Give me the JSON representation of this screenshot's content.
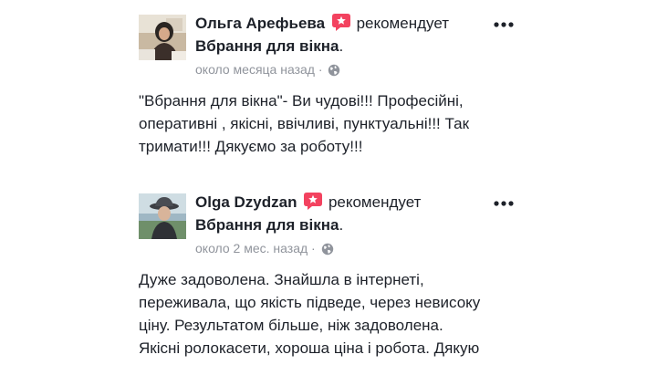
{
  "posts": [
    {
      "author": "Ольга Арефьева",
      "verb": "рекомендует",
      "page": "Вбрання для вікна",
      "page_suffix": ".",
      "time": "около месяца назад",
      "time_sep": "·",
      "privacy_icon": "globe-icon",
      "text": "\"Вбрання для вікна\"- Ви чудові!!! Професійні,\nоперативні , якісні, ввічливі, пунктуальні!!! Так\nтримати!!! Дякуємо за роботу!!!"
    },
    {
      "author": "Olga Dzydzan",
      "verb": "рекомендует",
      "page": "Вбрання для вікна",
      "page_suffix": ".",
      "time": "около 2 мес. назад",
      "time_sep": "·",
      "privacy_icon": "globe-icon",
      "text": "Дуже задоволена. Знайшла в інтернеті,\nпереживала, що якість підведе, через невисоку\nціну. Результатом більше, ніж задоволена.\nЯкісні ролокасети, хороша ціна і робота. Дякую"
    }
  ],
  "colors": {
    "recommend_badge": "#f3425f",
    "text": "#1d2129",
    "meta": "#90949c"
  },
  "icons": {
    "recommend": "recommend-star-icon",
    "more": "more-options-icon"
  }
}
